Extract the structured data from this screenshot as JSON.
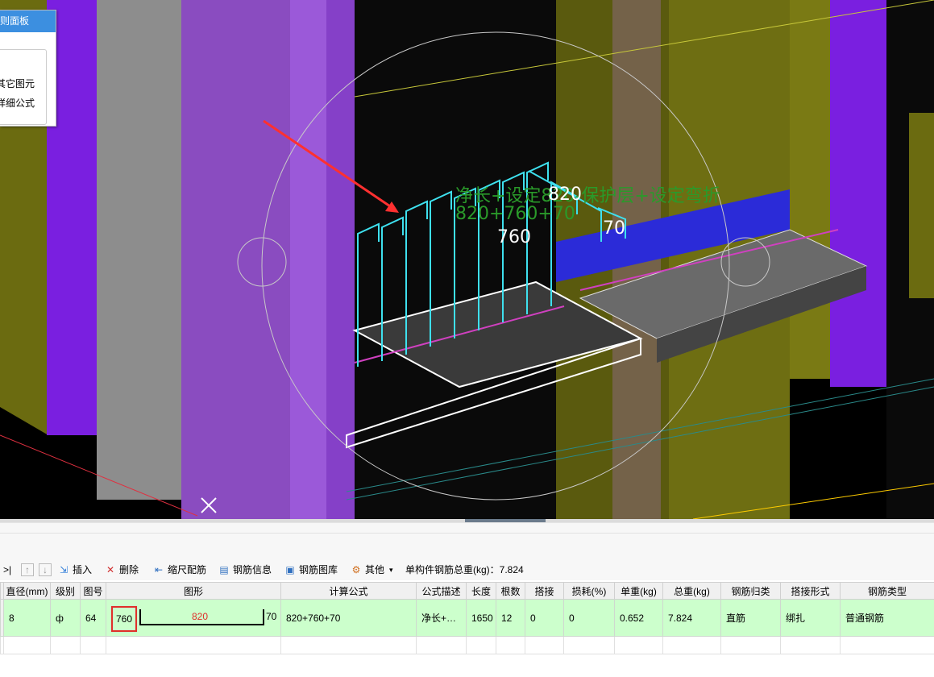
{
  "viewport": {
    "dimension_labels": {
      "formula_text": "净长+设定820-保护层+设定弯折",
      "formula_values": "820+760+70",
      "top_value": "820",
      "left_value": "760",
      "right_value": "70"
    }
  },
  "side_panel": {
    "title": "则面板",
    "items": [
      "其它图元",
      "详细公式"
    ]
  },
  "toolbar": {
    "nav_end": ">|",
    "insert_label": "插入",
    "delete_label": "删除",
    "scale_label": "缩尺配筋",
    "info_label": "钢筋信息",
    "library_label": "钢筋图库",
    "other_label": "其他",
    "total_weight_label": "单构件钢筋总重(kg)：7.824"
  },
  "grid": {
    "columns": [
      "直径(mm)",
      "级别",
      "图号",
      "图形",
      "计算公式",
      "公式描述",
      "长度",
      "根数",
      "搭接",
      "损耗(%)",
      "单重(kg)",
      "总重(kg)",
      "钢筋归类",
      "搭接形式",
      "钢筋类型"
    ],
    "rows": [
      {
        "diameter": "8",
        "grade": "ф",
        "figure_no": "64",
        "shape_left": "760",
        "shape_mid": "820",
        "shape_right": "70",
        "formula": "820+760+70",
        "formula_desc": "净长+…",
        "length": "1650",
        "count": "12",
        "lap": "0",
        "loss": "0",
        "unit_weight": "0.652",
        "total_weight": "7.824",
        "category": "直筋",
        "lap_type": "绑扎",
        "bar_type": "普通钢筋"
      }
    ]
  }
}
